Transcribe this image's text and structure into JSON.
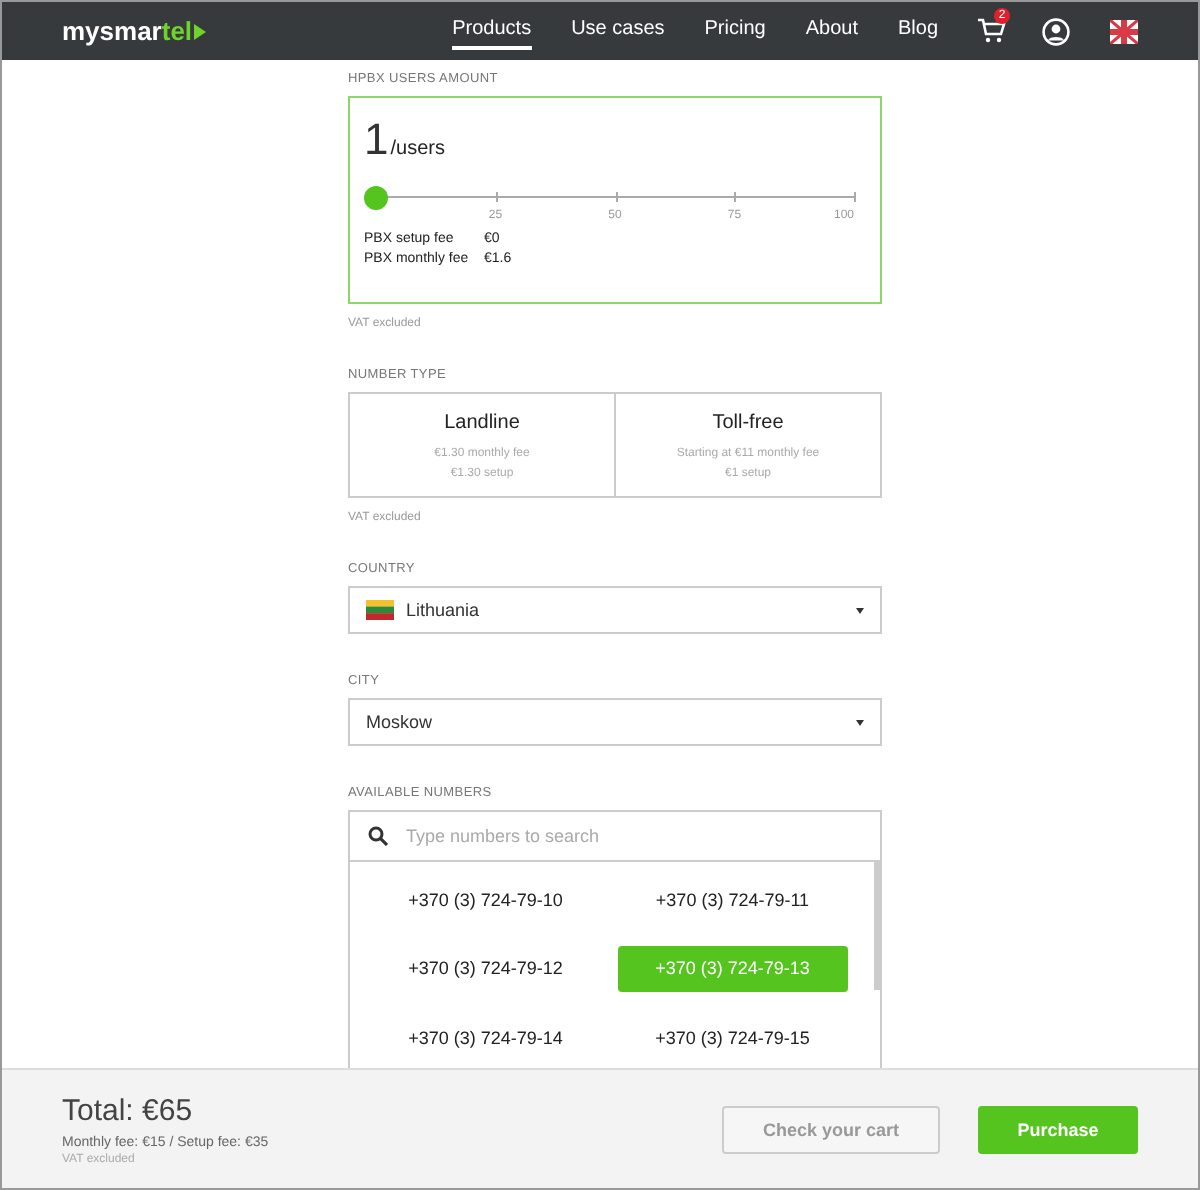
{
  "header": {
    "logo": {
      "text": "mysmar",
      "accent": "tel"
    },
    "nav": [
      {
        "label": "Products",
        "selected": true
      },
      {
        "label": "Use cases",
        "selected": false
      },
      {
        "label": "Pricing",
        "selected": false
      },
      {
        "label": "About",
        "selected": false
      },
      {
        "label": "Blog",
        "selected": false
      }
    ],
    "cart_count": "2"
  },
  "users": {
    "label": "HPBX USERS AMOUNT",
    "value": "1",
    "unit": "/users",
    "level": 0,
    "ticks": [
      "25",
      "50",
      "75",
      "100"
    ],
    "fees": [
      {
        "name": "PBX setup fee",
        "value": "€0"
      },
      {
        "name": "PBX monthly fee",
        "value": "€1.6"
      }
    ],
    "note": "VAT excluded"
  },
  "number_type": {
    "label": "NUMBER TYPE",
    "options": [
      {
        "title": "Landline",
        "lines": [
          "€1.30 monthly fee",
          "€1.30 setup"
        ]
      },
      {
        "title": "Toll-free",
        "lines": [
          "Starting at €11 monthly fee",
          "€1 setup"
        ]
      }
    ],
    "note": "VAT excluded"
  },
  "country": {
    "label": "COUNTRY",
    "value": "Lithuania"
  },
  "city": {
    "label": "CITY",
    "value": "Moskow"
  },
  "numbers": {
    "label": "AVAILABLE NUMBERS",
    "placeholder": "Type numbers to search",
    "items": [
      {
        "number": "+370 (3) 724-79-10",
        "selected": false
      },
      {
        "number": "+370 (3) 724-79-11",
        "selected": false
      },
      {
        "number": "+370 (3) 724-79-12",
        "selected": false
      },
      {
        "number": "+370 (3) 724-79-13",
        "selected": true
      },
      {
        "number": "+370 (3) 724-79-14",
        "selected": false
      },
      {
        "number": "+370 (3) 724-79-15",
        "selected": false
      }
    ]
  },
  "footer": {
    "total": "Total: €65",
    "fees": "Monthly fee: €15 / Setup fee: €35",
    "note": "VAT excluded",
    "buttons": [
      "Check your cart",
      "Purchase"
    ]
  }
}
